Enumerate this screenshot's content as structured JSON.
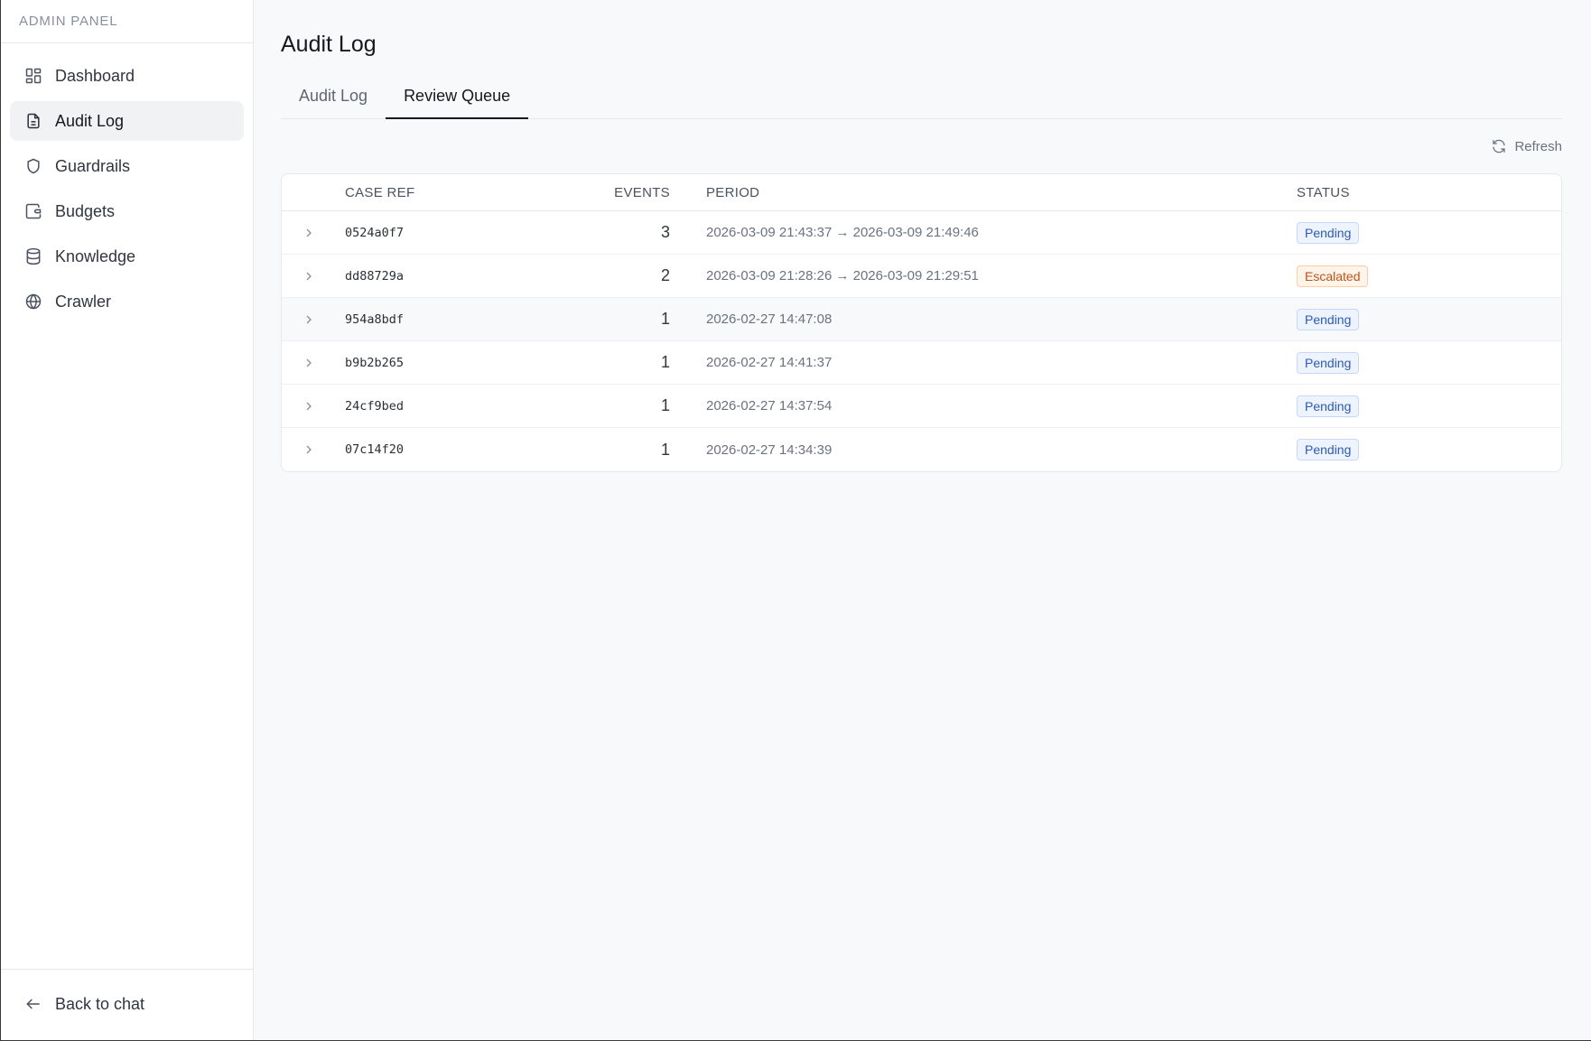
{
  "sidebar": {
    "title": "ADMIN PANEL",
    "items": [
      {
        "label": "Dashboard",
        "icon": "grid-icon"
      },
      {
        "label": "Audit Log",
        "icon": "file-text-icon"
      },
      {
        "label": "Guardrails",
        "icon": "shield-icon"
      },
      {
        "label": "Budgets",
        "icon": "wallet-icon"
      },
      {
        "label": "Knowledge",
        "icon": "database-icon"
      },
      {
        "label": "Crawler",
        "icon": "globe-icon"
      }
    ],
    "active_item": "Audit Log",
    "footer_label": "Back to chat"
  },
  "page": {
    "title": "Audit Log",
    "tabs": [
      {
        "label": "Audit Log"
      },
      {
        "label": "Review Queue"
      }
    ],
    "active_tab": "Review Queue",
    "refresh_label": "Refresh"
  },
  "table": {
    "columns": {
      "case_ref": "CASE REF",
      "events": "EVENTS",
      "period": "PERIOD",
      "status": "STATUS"
    },
    "rows": [
      {
        "case_ref": "0524a0f7",
        "events": "3",
        "period": "2026-03-09 21:43:37 → 2026-03-09 21:49:46",
        "status": "Pending"
      },
      {
        "case_ref": "dd88729a",
        "events": "2",
        "period": "2026-03-09 21:28:26 → 2026-03-09 21:29:51",
        "status": "Escalated"
      },
      {
        "case_ref": "954a8bdf",
        "events": "1",
        "period": "2026-02-27 14:47:08",
        "status": "Pending"
      },
      {
        "case_ref": "b9b2b265",
        "events": "1",
        "period": "2026-02-27 14:41:37",
        "status": "Pending"
      },
      {
        "case_ref": "24cf9bed",
        "events": "1",
        "period": "2026-02-27 14:37:54",
        "status": "Pending"
      },
      {
        "case_ref": "07c14f20",
        "events": "1",
        "period": "2026-02-27 14:34:39",
        "status": "Pending"
      }
    ]
  },
  "colors": {
    "pending": "#2b59c3",
    "escalated": "#c2521b",
    "active_tab_underline": "#15181f"
  }
}
